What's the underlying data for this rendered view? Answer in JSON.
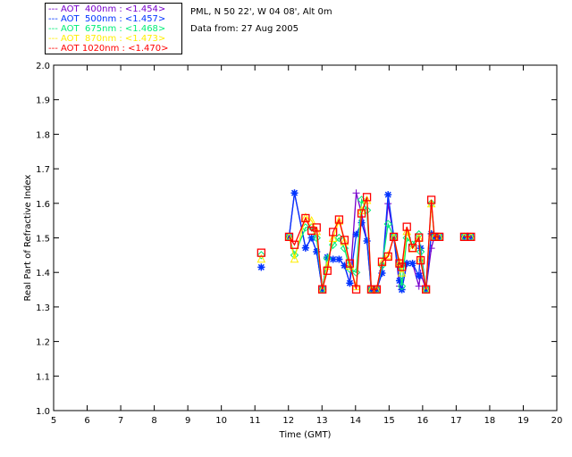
{
  "header": {
    "location": "PML, N 50 22', W 04 08', Alt 0m",
    "date_line": "Data from: 27 Aug 2005"
  },
  "chart_data": {
    "type": "line",
    "xlabel": "Time (GMT)",
    "ylabel": "Real Part of Refractive Index",
    "xlim": [
      5,
      20
    ],
    "ylim": [
      1.0,
      2.0
    ],
    "xticks": [
      "5",
      "6",
      "7",
      "8",
      "9",
      "10",
      "11",
      "12",
      "13",
      "14",
      "15",
      "16",
      "17",
      "18",
      "19",
      "20"
    ],
    "yticks": [
      "1.0",
      "1.1",
      "1.2",
      "1.3",
      "1.4",
      "1.5",
      "1.6",
      "1.7",
      "1.8",
      "1.9",
      "2.0"
    ],
    "grid": false,
    "legend_position": "top-left",
    "x": [
      11.19,
      12.02,
      12.18,
      12.51,
      12.69,
      12.84,
      13.01,
      13.16,
      13.33,
      13.51,
      13.67,
      13.83,
      14.02,
      14.18,
      14.34,
      14.47,
      14.63,
      14.79,
      14.97,
      15.14,
      15.31,
      15.38,
      15.53,
      15.7,
      15.89,
      15.94,
      16.1,
      16.26,
      16.35,
      16.5,
      17.24,
      17.44
    ],
    "series": [
      {
        "name": "AOT  400nm : <1.454>",
        "color": "#7700cc",
        "marker": "plus",
        "values": [
          1.415,
          1.503,
          1.63,
          1.471,
          1.5,
          1.46,
          1.351,
          1.444,
          1.438,
          1.438,
          1.42,
          1.369,
          1.63,
          1.57,
          1.491,
          1.351,
          1.351,
          1.398,
          1.599,
          1.503,
          1.36,
          1.35,
          1.426,
          1.426,
          1.36,
          1.398,
          1.351,
          1.47,
          1.503,
          1.503,
          1.503,
          1.503
        ]
      },
      {
        "name": "AOT  500nm : <1.457>",
        "color": "#0033ff",
        "marker": "star",
        "values": [
          1.415,
          1.503,
          1.63,
          1.471,
          1.5,
          1.46,
          1.351,
          1.444,
          1.438,
          1.438,
          1.42,
          1.369,
          1.51,
          1.544,
          1.491,
          1.351,
          1.351,
          1.398,
          1.625,
          1.503,
          1.376,
          1.35,
          1.426,
          1.426,
          1.39,
          1.47,
          1.351,
          1.512,
          1.503,
          1.503,
          1.503,
          1.503
        ]
      },
      {
        "name": "AOT  675nm : <1.468>",
        "color": "#00ee77",
        "marker": "diamond",
        "values": [
          1.45,
          1.503,
          1.45,
          1.53,
          1.53,
          1.5,
          1.351,
          1.44,
          1.48,
          1.5,
          1.47,
          1.41,
          1.4,
          1.61,
          1.58,
          1.351,
          1.351,
          1.42,
          1.54,
          1.503,
          1.42,
          1.36,
          1.5,
          1.48,
          1.51,
          1.46,
          1.351,
          1.6,
          1.503,
          1.503,
          1.503,
          1.503
        ]
      },
      {
        "name": "AOT  870nm : <1.473>",
        "color": "#ffee00",
        "marker": "triangle",
        "values": [
          1.44,
          1.503,
          1.44,
          1.56,
          1.55,
          1.52,
          1.351,
          1.42,
          1.5,
          1.55,
          1.49,
          1.42,
          1.36,
          1.58,
          1.61,
          1.351,
          1.351,
          1.43,
          1.45,
          1.503,
          1.43,
          1.4,
          1.52,
          1.47,
          1.5,
          1.44,
          1.351,
          1.6,
          1.503,
          1.503,
          1.503,
          1.503
        ]
      },
      {
        "name": "AOT 1020nm : <1.470>",
        "color": "#ff0000",
        "marker": "square",
        "values": [
          1.457,
          1.503,
          1.48,
          1.557,
          1.521,
          1.53,
          1.351,
          1.405,
          1.517,
          1.553,
          1.494,
          1.426,
          1.351,
          1.571,
          1.618,
          1.351,
          1.351,
          1.431,
          1.446,
          1.503,
          1.426,
          1.416,
          1.532,
          1.471,
          1.501,
          1.435,
          1.351,
          1.61,
          1.503,
          1.503,
          1.503,
          1.503
        ]
      }
    ]
  }
}
